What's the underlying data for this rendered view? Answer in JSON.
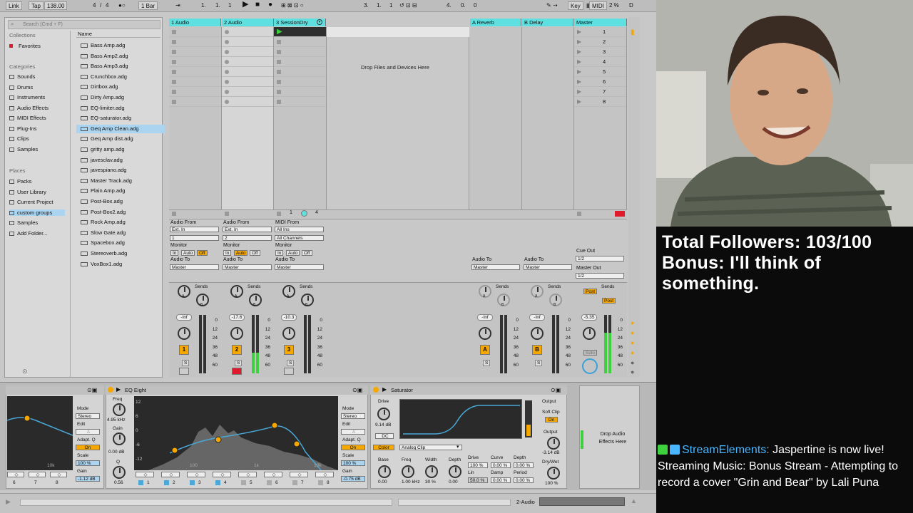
{
  "topbar": {
    "link": "Link",
    "tap": "Tap",
    "tempo": "138.00",
    "sig_num": "4",
    "sig_sep": "/",
    "sig_den": "4",
    "quant": "1 Bar",
    "pos1": "1.",
    "pos2": "1.",
    "pos3": "1",
    "arr_pos": "3.",
    "arr_pos2": "1.",
    "arr_pos3": "1",
    "loop_len": "4.",
    "loop_len2": "0.",
    "loop_len3": "0",
    "key": "Key",
    "midi": "MIDI",
    "cpu": "2 %",
    "d": "D"
  },
  "browser": {
    "search_placeholder": "Search (Cmd + F)",
    "collections_header": "Collections",
    "favorites": "Favorites",
    "categories_header": "Categories",
    "categories": [
      "Sounds",
      "Drums",
      "Instruments",
      "Audio Effects",
      "MIDI Effects",
      "Plug-Ins",
      "Clips",
      "Samples"
    ],
    "places_header": "Places",
    "places": [
      "Packs",
      "User Library",
      "Current Project",
      "custom groups",
      "Samples",
      "Add Folder..."
    ],
    "name_header": "Name",
    "files": [
      "Bass Amp.adg",
      "Bass Amp2.adg",
      "Bass Amp3.adg",
      "Crunchbox.adg",
      "Dirtbox.adg",
      "Dirty Amp.adg",
      "EQ-limiter.adg",
      "EQ-saturator.adg",
      "Geq Amp Clean.adg",
      "Geq Amp dist.adg",
      "gritty amp.adg",
      "javesclav.adg",
      "javespiano.adg",
      "Master Track.adg",
      "Plain Amp.adg",
      "Post-Box.adg",
      "Post-Box2.adg",
      "Rock Amp.adg",
      "Slow Gate.adg",
      "Spacebox.adg",
      "Stereoverb.adg",
      "VoxBox1.adg"
    ],
    "selected_file_index": 8
  },
  "session": {
    "tracks": [
      {
        "name": "1 Audio",
        "audio_from_label": "Audio From",
        "input": "Ext. In",
        "channel": "1",
        "monitor_label": "Monitor",
        "mon_in": "In",
        "mon_auto": "Auto",
        "mon_off": "Off",
        "audio_to_label": "Audio To",
        "output": "Master",
        "volume": "-Inf",
        "number": "1",
        "sends_label": "Sends"
      },
      {
        "name": "2 Audio",
        "audio_from_label": "Audio From",
        "input": "Ext. In",
        "channel": "2",
        "monitor_label": "Monitor",
        "mon_in": "In",
        "mon_auto": "Auto",
        "mon_off": "Off",
        "audio_to_label": "Audio To",
        "output": "Master",
        "volume": "-17.6",
        "number": "2",
        "sends_label": "Sends"
      },
      {
        "name": "3 SessionDry",
        "audio_from_label": "MIDI From",
        "input": "All Ins",
        "channel": "All Channels",
        "monitor_label": "Monitor",
        "mon_in": "In",
        "mon_auto": "Auto",
        "mon_off": "Off",
        "audio_to_label": "Audio To",
        "output": "Master",
        "volume": "-10.3",
        "number": "3",
        "sends_label": "Sends"
      }
    ],
    "returns": [
      {
        "name": "A Reverb",
        "audio_to_label": "Audio To",
        "output": "Master",
        "volume": "-Inf",
        "letter": "A",
        "sends_label": "Sends"
      },
      {
        "name": "B Delay",
        "audio_to_label": "Audio To",
        "output": "Master",
        "volume": "-Inf",
        "letter": "B",
        "sends_label": "Sends"
      }
    ],
    "master": {
      "name": "Master",
      "cue_out_label": "Cue Out",
      "cue_out": "1/2",
      "master_out_label": "Master Out",
      "master_out": "1/2",
      "volume": "-5.35",
      "sends_label": "Sends",
      "post1": "Post",
      "post2": "Post",
      "solo": "Solo"
    },
    "scenes": [
      "1",
      "2",
      "3",
      "4",
      "5",
      "6",
      "7",
      "8"
    ],
    "drop_text": "Drop Files and Devices Here",
    "track3_slot_info": [
      "1",
      "4"
    ],
    "meter_scale": [
      "0",
      "12",
      "24",
      "36",
      "48",
      "60"
    ],
    "send_labels": [
      "A",
      "B"
    ]
  },
  "devices": {
    "eq_title": "EQ Eight",
    "eq_left": {
      "freq_label": "Freq",
      "freq": "4.95 kHz",
      "gain_label": "Gain",
      "gain": "0.00 dB",
      "q_label": "Q",
      "q": "0.56",
      "mode_label": "Mode",
      "mode": "Stereo",
      "edit_label": "Edit",
      "edit": "A",
      "adapt_label": "Adapt. Q",
      "adapt": "On",
      "scale_label": "Scale",
      "scale": "100 %",
      "gain2_label": "Gain",
      "gain2": "-1.12 dB"
    },
    "eq_right": {
      "mode_label": "Mode",
      "mode": "Stereo",
      "edit_label": "Edit",
      "edit": "A",
      "adapt_label": "Adapt. Q",
      "adapt": "On",
      "scale_label": "Scale",
      "scale": "100 %",
      "gain_label": "Gain",
      "gain": "-0.75 dB"
    },
    "eq_axis": [
      "12",
      "6",
      "0",
      "-6",
      "-12"
    ],
    "eq_freqs": [
      "100",
      "1k",
      "10k"
    ],
    "eq_left_freqs": [
      "10k"
    ],
    "eq_bands": [
      "1",
      "2",
      "3",
      "4",
      "5",
      "6",
      "7",
      "8"
    ],
    "eq_left_bands": [
      "6",
      "7",
      "8"
    ],
    "saturator": {
      "title": "Saturator",
      "drive_label": "Drive",
      "drive": "9.14 dB",
      "dc": "DC",
      "color": "Color",
      "mode": "Analog Clip",
      "output_label": "Output",
      "soft_clip_label": "Soft Clip",
      "soft_clip": "On",
      "output_knob_label": "Output",
      "output_val": "-3.14 dB",
      "drywet_label": "Dry/Wet",
      "drywet": "100 %",
      "base_label": "Base",
      "base": "0.00",
      "freq_label": "Freq",
      "freq": "1.00 kHz",
      "width_label": "Width",
      "width": "30 %",
      "depth_label": "Depth",
      "depth": "0.00",
      "drive2_label": "Drive",
      "drive2": "100 %",
      "lin_label": "Lin",
      "lin": "50.0 %",
      "curve_label": "Curve",
      "curve": "0.00 %",
      "damp_label": "Damp",
      "damp": "0.00 %",
      "depth2_label": "Depth",
      "depth2": "0.00 %",
      "period_label": "Period",
      "period": "0.00 %"
    },
    "drop_effects": "Drop Audio Effects Here"
  },
  "statusbar": {
    "track": "2-Audio"
  },
  "overlay": {
    "line1": "Total Followers: 103/100",
    "line2": "Bonus: I'll think of",
    "line3": "something.",
    "chat_user": "StreamElements",
    "chat_sep": ":",
    "chat_msg": "Jaspertine is now live! Streaming Music: Bonus Stream - Attempting to record a cover \"Grin and Bear\" by Lali Puna"
  },
  "colors": {
    "track_header": "#5fe0e0",
    "accent": "#f7a800",
    "meter_green": "#3dd13d",
    "chat_name": "#49b6ff",
    "eq_curve": "#4aa8d8"
  }
}
